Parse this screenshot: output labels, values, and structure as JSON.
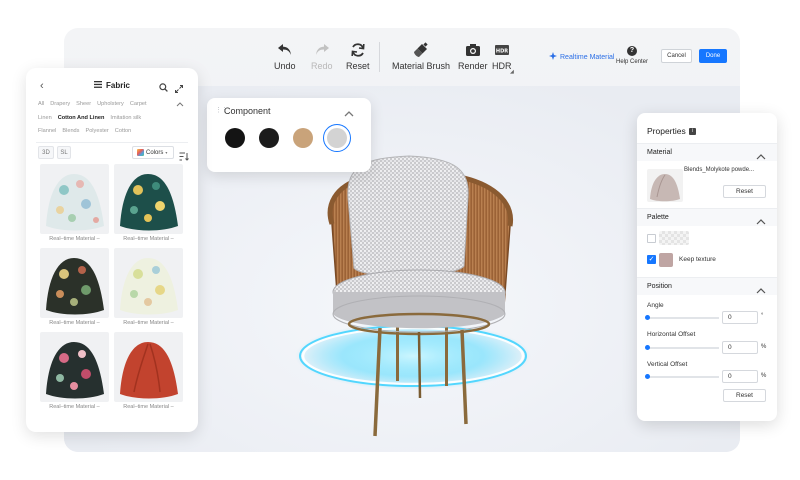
{
  "toolbar": {
    "undo": "Undo",
    "redo": "Redo",
    "reset": "Reset",
    "material_brush": "Material Brush",
    "render": "Render",
    "hdr": "HDR",
    "realtime_material": "Realtime Material",
    "help_center": "Help Center",
    "cancel": "Cancel",
    "done": "Done"
  },
  "fabric_panel": {
    "title": "Fabric",
    "categories_row1": [
      "All",
      "Drapery",
      "Sheer",
      "Upholstery",
      "Carpet"
    ],
    "categories_row2": [
      "Linen",
      "Cotton And Linen",
      "Imitation silk"
    ],
    "categories_row3": [
      "Flannel",
      "Blends",
      "Polyester",
      "Cotton"
    ],
    "active_category": "Cotton And Linen",
    "view_3d": "3D",
    "view_sl": "SL",
    "colors_label": "Colors",
    "swatch_labels": [
      "Real–time Material –",
      "Real–time Material –",
      "Real–time Material –",
      "Real–time Material –",
      "Real–time Material –",
      "Real–time Material –"
    ]
  },
  "component": {
    "title": "Component",
    "swatch_colors": [
      "#141414",
      "#1c1c1c",
      "#c9a37a",
      "#d3d3d3"
    ],
    "selected_index": 3
  },
  "properties": {
    "title": "Properties",
    "material_section": "Material",
    "material_name": "Blends_Molykote powde...",
    "material_reset": "Reset",
    "palette_section": "Palette",
    "keep_texture": "Keep texture",
    "keep_texture_checked": true,
    "position_section": "Position",
    "angle_label": "Angle",
    "angle_value": "0",
    "angle_unit": "°",
    "hoffset_label": "Horizontal Offset",
    "hoffset_value": "0",
    "hoffset_unit": "%",
    "voffset_label": "Vertical Offset",
    "voffset_value": "0",
    "voffset_unit": "%",
    "position_reset": "Reset"
  },
  "colors": {
    "accent": "#1677ff",
    "chair_frame": "#a46a3a",
    "cushion": "#d9d9dc",
    "glow": "#2fd0ff"
  }
}
